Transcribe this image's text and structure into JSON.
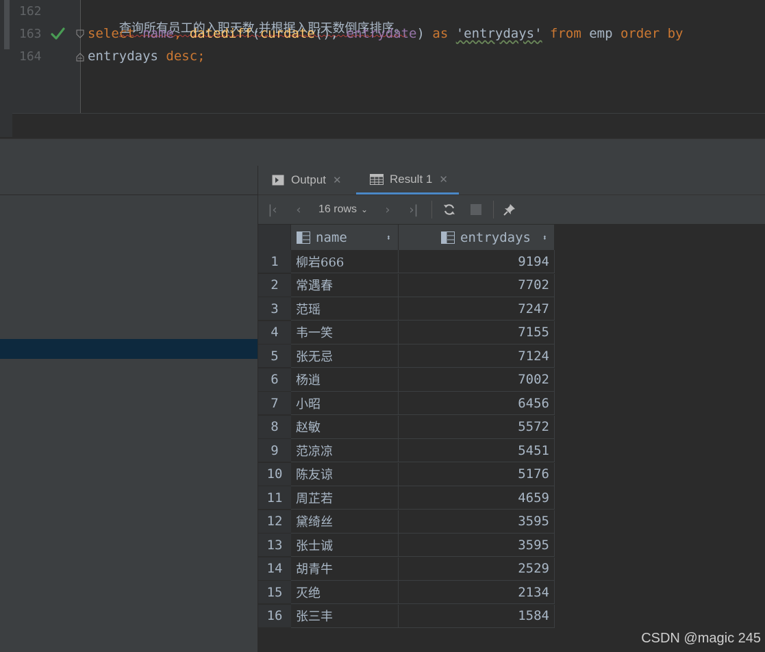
{
  "editor": {
    "lines": [
      {
        "number": "162",
        "comment": "查询所有员工的入职天数,并根据入职天数倒序排序。"
      },
      {
        "number": "163",
        "tokens": [
          {
            "t": "select ",
            "c": "kw"
          },
          {
            "t": "name",
            "c": "col"
          },
          {
            "t": ", ",
            "c": "kw"
          },
          {
            "t": "datediff",
            "c": "fn"
          },
          {
            "t": "(",
            "c": "plain"
          },
          {
            "t": "curdate",
            "c": "fn"
          },
          {
            "t": "(), ",
            "c": "plain"
          },
          {
            "t": "entrydate",
            "c": "col"
          },
          {
            "t": ") ",
            "c": "plain"
          },
          {
            "t": "as ",
            "c": "kw"
          },
          {
            "t": "'entrydays'",
            "c": "str"
          },
          {
            "t": " ",
            "c": "plain"
          },
          {
            "t": "from ",
            "c": "kw"
          },
          {
            "t": "emp ",
            "c": "plain"
          },
          {
            "t": "order by",
            "c": "kw"
          }
        ]
      },
      {
        "number": "164",
        "tokens": [
          {
            "t": "entrydays ",
            "c": "plain"
          },
          {
            "t": "desc;",
            "c": "kw"
          }
        ]
      }
    ]
  },
  "tabs": [
    {
      "label": "Output",
      "icon": "output-console-icon",
      "active": false
    },
    {
      "label": "Result 1",
      "icon": "table-grid-icon",
      "active": true
    }
  ],
  "toolbar": {
    "rows_label": "16 rows"
  },
  "grid": {
    "columns": [
      "name",
      "entrydays"
    ],
    "rows": [
      {
        "n": "1",
        "name": "柳岩666",
        "entrydays": "9194"
      },
      {
        "n": "2",
        "name": "常遇春",
        "entrydays": "7702"
      },
      {
        "n": "3",
        "name": "范瑶",
        "entrydays": "7247"
      },
      {
        "n": "4",
        "name": "韦一笑",
        "entrydays": "7155"
      },
      {
        "n": "5",
        "name": "张无忌",
        "entrydays": "7124"
      },
      {
        "n": "6",
        "name": "杨逍",
        "entrydays": "7002"
      },
      {
        "n": "7",
        "name": "小昭",
        "entrydays": "6456"
      },
      {
        "n": "8",
        "name": "赵敏",
        "entrydays": "5572"
      },
      {
        "n": "9",
        "name": "范凉凉",
        "entrydays": "5451"
      },
      {
        "n": "10",
        "name": "陈友谅",
        "entrydays": "5176"
      },
      {
        "n": "11",
        "name": "周芷若",
        "entrydays": "4659"
      },
      {
        "n": "12",
        "name": "黛绮丝",
        "entrydays": "3595"
      },
      {
        "n": "13",
        "name": "张士诚",
        "entrydays": "3595"
      },
      {
        "n": "14",
        "name": "胡青牛",
        "entrydays": "2529"
      },
      {
        "n": "15",
        "name": "灭绝",
        "entrydays": "2134"
      },
      {
        "n": "16",
        "name": "张三丰",
        "entrydays": "1584"
      }
    ]
  },
  "watermark": "CSDN @magic 245",
  "colors": {
    "keyword": "#cc7832",
    "function": "#ffc66d",
    "column": "#9876aa",
    "check": "#499c54",
    "tab_underline": "#4a88c7",
    "selection": "#0d293e"
  }
}
